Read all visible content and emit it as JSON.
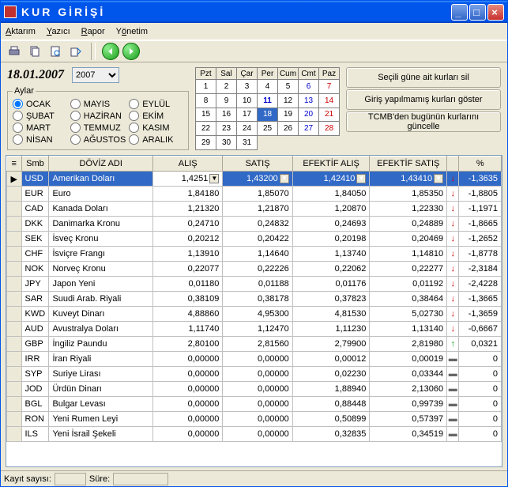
{
  "title": "KUR GİRİŞİ",
  "menu": {
    "aktarim": "Aktarım",
    "yazici": "Yazıcı",
    "rapor": "Rapor",
    "yonetim": "Yönetim"
  },
  "date": {
    "display": "18.01.2007",
    "year": "2007"
  },
  "months": {
    "legend": "Aylar",
    "items": [
      "OCAK",
      "ŞUBAT",
      "MART",
      "NİSAN",
      "MAYIS",
      "HAZİRAN",
      "TEMMUZ",
      "AĞUSTOS",
      "EYLÜL",
      "EKİM",
      "KASIM",
      "ARALIK"
    ],
    "selected": "OCAK"
  },
  "calendar": {
    "headers": [
      "Pzt",
      "Sal",
      "Çar",
      "Per",
      "Cum",
      "Cmt",
      "Paz"
    ],
    "weeks": [
      [
        1,
        2,
        3,
        4,
        5,
        6,
        7
      ],
      [
        8,
        9,
        10,
        11,
        12,
        13,
        14
      ],
      [
        15,
        16,
        17,
        18,
        19,
        20,
        21
      ],
      [
        22,
        23,
        24,
        25,
        26,
        27,
        28
      ],
      [
        29,
        30,
        31,
        null,
        null,
        null,
        null
      ]
    ],
    "selected_day": 18,
    "highlight_day": 11
  },
  "buttons": {
    "delete": "Seçili güne ait kurları sil",
    "show_missing": "Giriş yapılmamış kurları göster",
    "tcmb": "TCMB'den bugünün kurlarını güncelle"
  },
  "grid": {
    "headers": {
      "smb": "Smb",
      "name": "DÖVİZ ADI",
      "alis": "ALIŞ",
      "satis": "SATIŞ",
      "efalis": "EFEKTİF ALIŞ",
      "efsatis": "EFEKTİF SATIŞ",
      "pct": "%"
    },
    "edit_value": "1,4251",
    "rows": [
      {
        "smb": "USD",
        "name": "Amerikan Doları",
        "alis": "1,42510",
        "satis": "1,43200",
        "efalis": "1,42410",
        "efsatis": "1,43410",
        "dir": "down",
        "pct": "-1,3635",
        "sel": true
      },
      {
        "smb": "EUR",
        "name": "Euro",
        "alis": "1,84180",
        "satis": "1,85070",
        "efalis": "1,84050",
        "efsatis": "1,85350",
        "dir": "down",
        "pct": "-1,8805"
      },
      {
        "smb": "CAD",
        "name": "Kanada Doları",
        "alis": "1,21320",
        "satis": "1,21870",
        "efalis": "1,20870",
        "efsatis": "1,22330",
        "dir": "down",
        "pct": "-1,1971"
      },
      {
        "smb": "DKK",
        "name": "Danimarka Kronu",
        "alis": "0,24710",
        "satis": "0,24832",
        "efalis": "0,24693",
        "efsatis": "0,24889",
        "dir": "down",
        "pct": "-1,8665"
      },
      {
        "smb": "SEK",
        "name": "İsveç Kronu",
        "alis": "0,20212",
        "satis": "0,20422",
        "efalis": "0,20198",
        "efsatis": "0,20469",
        "dir": "down",
        "pct": "-1,2652"
      },
      {
        "smb": "CHF",
        "name": "İsviçre Frangı",
        "alis": "1,13910",
        "satis": "1,14640",
        "efalis": "1,13740",
        "efsatis": "1,14810",
        "dir": "down",
        "pct": "-1,8778"
      },
      {
        "smb": "NOK",
        "name": "Norveç Kronu",
        "alis": "0,22077",
        "satis": "0,22226",
        "efalis": "0,22062",
        "efsatis": "0,22277",
        "dir": "down",
        "pct": "-2,3184"
      },
      {
        "smb": "JPY",
        "name": "Japon Yeni",
        "alis": "0,01180",
        "satis": "0,01188",
        "efalis": "0,01176",
        "efsatis": "0,01192",
        "dir": "down",
        "pct": "-2,4228"
      },
      {
        "smb": "SAR",
        "name": "Suudi Arab. Riyali",
        "alis": "0,38109",
        "satis": "0,38178",
        "efalis": "0,37823",
        "efsatis": "0,38464",
        "dir": "down",
        "pct": "-1,3665"
      },
      {
        "smb": "KWD",
        "name": "Kuveyt Dinarı",
        "alis": "4,88860",
        "satis": "4,95300",
        "efalis": "4,81530",
        "efsatis": "5,02730",
        "dir": "down",
        "pct": "-1,3659"
      },
      {
        "smb": "AUD",
        "name": "Avustralya Doları",
        "alis": "1,11740",
        "satis": "1,12470",
        "efalis": "1,11230",
        "efsatis": "1,13140",
        "dir": "down",
        "pct": "-0,6667"
      },
      {
        "smb": "GBP",
        "name": "İngiliz Paundu",
        "alis": "2,80100",
        "satis": "2,81560",
        "efalis": "2,79900",
        "efsatis": "2,81980",
        "dir": "up",
        "pct": "0,0321"
      },
      {
        "smb": "IRR",
        "name": "İran Riyali",
        "alis": "0,00000",
        "satis": "0,00000",
        "efalis": "0,00012",
        "efsatis": "0,00019",
        "dir": "none",
        "pct": "0"
      },
      {
        "smb": "SYP",
        "name": "Suriye Lirası",
        "alis": "0,00000",
        "satis": "0,00000",
        "efalis": "0,02230",
        "efsatis": "0,03344",
        "dir": "none",
        "pct": "0"
      },
      {
        "smb": "JOD",
        "name": "Ürdün Dinarı",
        "alis": "0,00000",
        "satis": "0,00000",
        "efalis": "1,88940",
        "efsatis": "2,13060",
        "dir": "none",
        "pct": "0"
      },
      {
        "smb": "BGL",
        "name": "Bulgar Levası",
        "alis": "0,00000",
        "satis": "0,00000",
        "efalis": "0,88448",
        "efsatis": "0,99739",
        "dir": "none",
        "pct": "0"
      },
      {
        "smb": "RON",
        "name": "Yeni Rumen Leyi",
        "alis": "0,00000",
        "satis": "0,00000",
        "efalis": "0,50899",
        "efsatis": "0,57397",
        "dir": "none",
        "pct": "0"
      },
      {
        "smb": "ILS",
        "name": "Yeni İsrail Şekeli",
        "alis": "0,00000",
        "satis": "0,00000",
        "efalis": "0,32835",
        "efsatis": "0,34519",
        "dir": "none",
        "pct": "0"
      }
    ]
  },
  "status": {
    "kayit_label": "Kayıt sayısı:",
    "kayit_value": "",
    "sure_label": "Süre:",
    "sure_value": ""
  }
}
